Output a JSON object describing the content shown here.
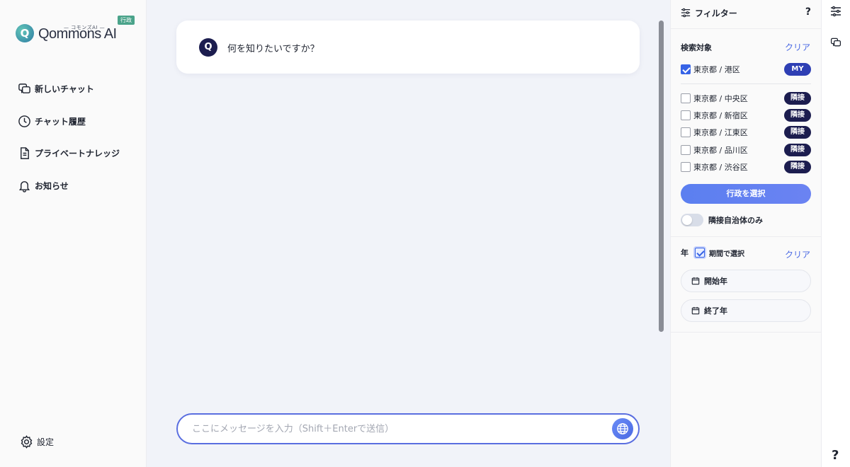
{
  "logo": {
    "mark": "Q",
    "subtitle": "— コモンズAI —",
    "name": "Qommons AI",
    "badge": "行政"
  },
  "sidebar": {
    "items": [
      {
        "label": "新しいチャット",
        "icon": "new-chat-icon"
      },
      {
        "label": "チャット履歴",
        "icon": "clock-icon"
      },
      {
        "label": "プライベートナレッジ",
        "icon": "document-icon"
      },
      {
        "label": "お知らせ",
        "icon": "bell-icon"
      }
    ],
    "settings_label": "設定"
  },
  "chat": {
    "avatar": "Q",
    "message": "何を知りたいですか？"
  },
  "composer": {
    "placeholder": "ここにメッセージを入力（Shift＋Enterで送信）",
    "value": ""
  },
  "filter": {
    "title": "フィルター",
    "help": "?",
    "target_section": {
      "title": "検索対象",
      "clear": "クリア",
      "my_item": {
        "label": "東京都 / 港区",
        "tag": "MY",
        "checked": true
      },
      "items": [
        {
          "label": "東京都 / 中央区",
          "tag": "隣接",
          "checked": false
        },
        {
          "label": "東京都 / 新宿区",
          "tag": "隣接",
          "checked": false
        },
        {
          "label": "東京都 / 江東区",
          "tag": "隣接",
          "checked": false
        },
        {
          "label": "東京都 / 品川区",
          "tag": "隣接",
          "checked": false
        },
        {
          "label": "東京都 / 渋谷区",
          "tag": "隣接",
          "checked": false
        }
      ],
      "select_button": "行政を選択",
      "toggle_label": "隣接自治体のみ"
    },
    "year_section": {
      "title": "年",
      "period_label": "期間で選択",
      "clear": "クリア",
      "start": "開始年",
      "end": "終了年"
    }
  },
  "rail": {
    "help": "?"
  },
  "colors": {
    "accent": "#4b6ae3",
    "navy": "#1c1d4f",
    "badge_green": "#4aa38a"
  }
}
